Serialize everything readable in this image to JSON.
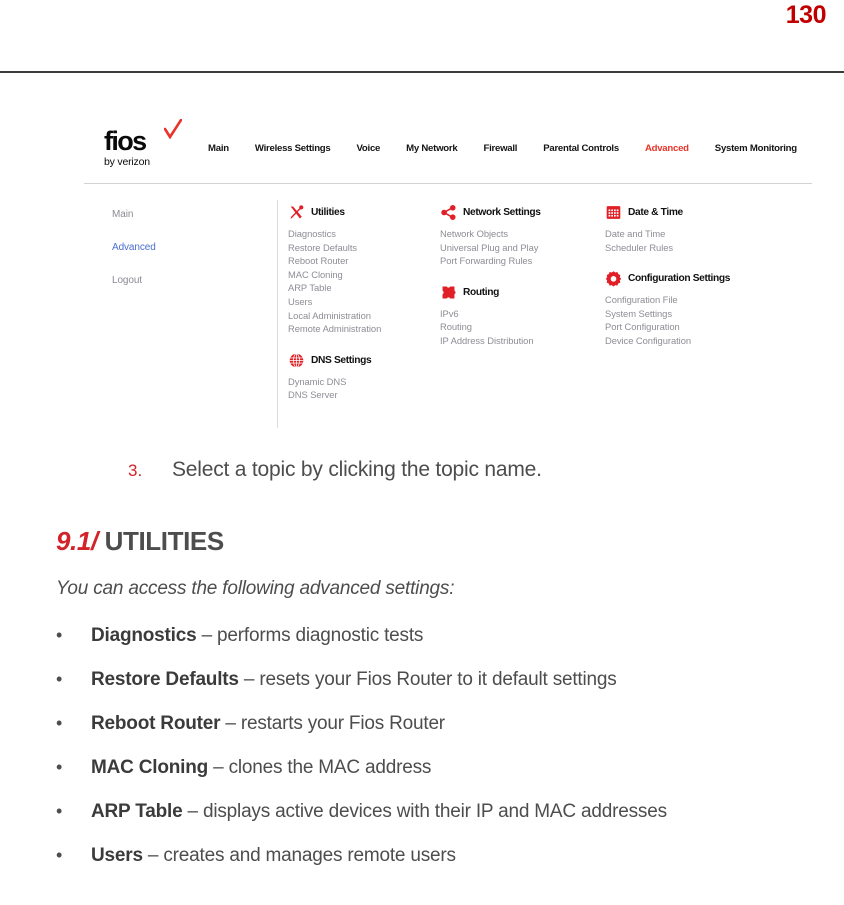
{
  "page": {
    "number": "130"
  },
  "screenshot": {
    "brand": {
      "word": "fios",
      "sub": "by verizon",
      "check_icon": "red-checkmark-icon"
    },
    "nav": [
      {
        "label": "Main",
        "active": false
      },
      {
        "label": "Wireless Settings",
        "active": false
      },
      {
        "label": "Voice",
        "active": false
      },
      {
        "label": "My Network",
        "active": false
      },
      {
        "label": "Firewall",
        "active": false
      },
      {
        "label": "Parental Controls",
        "active": false
      },
      {
        "label": "Advanced",
        "active": true
      },
      {
        "label": "System Monitoring",
        "active": false
      }
    ],
    "sidebar": [
      {
        "label": "Main",
        "active": false
      },
      {
        "label": "Advanced",
        "active": true
      },
      {
        "label": "Logout",
        "active": false
      }
    ],
    "columns": [
      {
        "groups": [
          {
            "title": "Utilities",
            "icon": "tools-icon",
            "items": [
              "Diagnostics",
              "Restore Defaults",
              "Reboot Router",
              "MAC Cloning",
              "ARP Table",
              "Users",
              "Local Administration",
              "Remote Administration"
            ]
          },
          {
            "title": "DNS Settings",
            "icon": "globe-icon",
            "items": [
              "Dynamic DNS",
              "DNS Server"
            ]
          }
        ]
      },
      {
        "groups": [
          {
            "title": "Network Settings",
            "icon": "share-nodes-icon",
            "items": [
              "Network Objects",
              "Universal Plug and Play",
              "Port Forwarding Rules"
            ]
          },
          {
            "title": "Routing",
            "icon": "puzzle-piece-icon",
            "items": [
              "IPv6",
              "Routing",
              "IP Address Distribution"
            ]
          }
        ]
      },
      {
        "groups": [
          {
            "title": "Date & Time",
            "icon": "calendar-icon",
            "items": [
              "Date and Time",
              "Scheduler Rules"
            ]
          },
          {
            "title": "Configuration Settings",
            "icon": "gear-icon",
            "items": [
              "Configuration File",
              "System Settings",
              "Port Configuration",
              "Device Configuration"
            ]
          }
        ]
      }
    ]
  },
  "step": {
    "number": "3.",
    "text": "Select a topic by clicking the topic name."
  },
  "section": {
    "number": "9.1/",
    "title": "UTILITIES",
    "intro": "You can access the following advanced settings:"
  },
  "bullets": [
    {
      "dot": "•",
      "term": "Diagnostics",
      "desc": " – performs diagnostic tests"
    },
    {
      "dot": "•",
      "term": "Restore Defaults",
      "desc": " – resets your Fios Router to it default settings"
    },
    {
      "dot": "•",
      "term": "Reboot Router",
      "desc": " – restarts your Fios Router"
    },
    {
      "dot": "•",
      "term": "MAC Cloning",
      "desc": " – clones the MAC address"
    },
    {
      "dot": "•",
      "term": "ARP Table",
      "desc": " – displays active devices with their IP and MAC addresses"
    },
    {
      "dot": "•",
      "term": "Users",
      "desc": " – creates and manages remote users"
    }
  ],
  "colors": {
    "accent_red": "#d2232a",
    "nav_active_red": "#e8342a",
    "icon_red": "#e01f26",
    "sidebar_active_blue": "#4a6fd0",
    "body_gray": "#4d4d4d"
  }
}
